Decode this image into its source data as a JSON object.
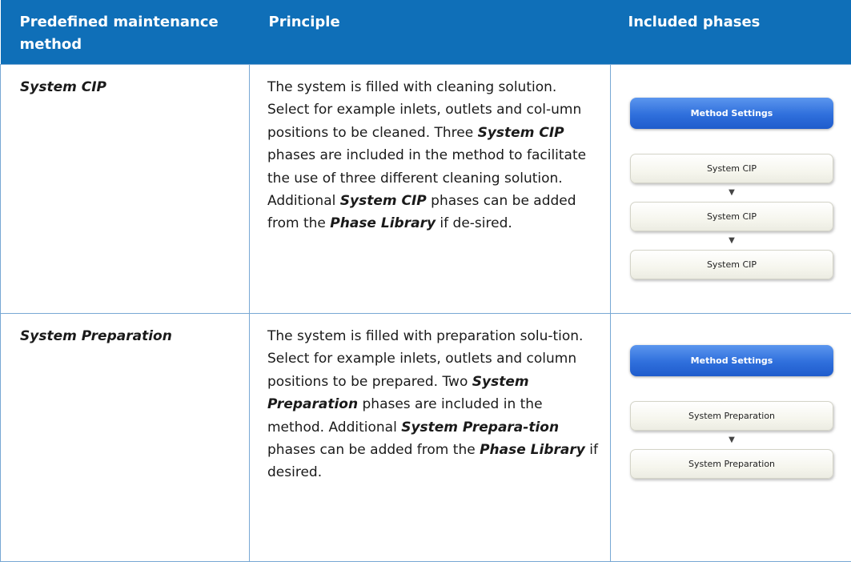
{
  "header": {
    "col1": "Predefined maintenance method",
    "col2": "Principle",
    "col3": "Included phases"
  },
  "rows": [
    {
      "name": "System CIP",
      "principle": {
        "t1": "The system is filled with cleaning solution. Select for example inlets, outlets and col-umn positions to be cleaned. Three ",
        "b1": "System CIP",
        "t2": " phases are included in the method to facilitate the use of three different cleaning solution. Additional ",
        "b2": "System CIP",
        "t3": " phases can be added from the ",
        "b3": "Phase Library",
        "t4": " if de-sired."
      },
      "settings_label": "Method Settings",
      "phases": [
        "System CIP",
        "System CIP",
        "System CIP"
      ]
    },
    {
      "name": "System Preparation",
      "principle": {
        "t1": "The system is filled with preparation solu-tion. Select for example inlets, outlets and column positions to be prepared. Two ",
        "b1": "System Preparation",
        "t2": " phases are included in the method. Additional ",
        "b2": "System Prepara-tion",
        "t3": " phases can be added from the ",
        "b3": "Phase Library",
        "t4": " if desired."
      },
      "settings_label": "Method Settings",
      "phases": [
        "System Preparation",
        "System Preparation"
      ]
    }
  ],
  "arrow_glyph": "▼",
  "colors": {
    "header_bg": "#0f6fb8",
    "border": "#78a8d4",
    "settings_button": "#2f6fdc"
  }
}
